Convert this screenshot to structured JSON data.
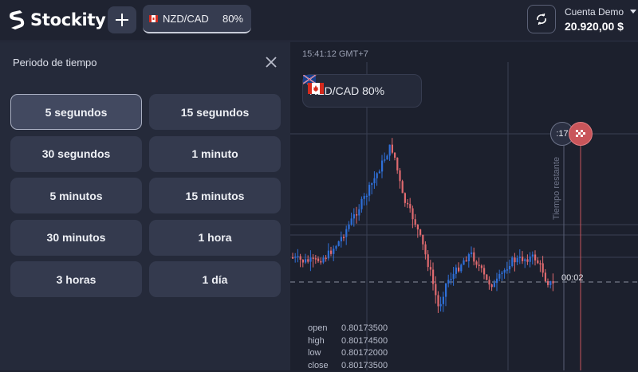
{
  "app": {
    "name": "Stockity"
  },
  "header": {
    "asset_tab": {
      "name": "NZD/CAD",
      "payout": "80%"
    },
    "account": {
      "label": "Cuenta Demo",
      "balance": "20.920,00 $"
    }
  },
  "timeframe_panel": {
    "title": "Periodo de tiempo",
    "options": [
      {
        "label": "5 segundos",
        "selected": true
      },
      {
        "label": "15 segundos",
        "selected": false
      },
      {
        "label": "30 segundos",
        "selected": false
      },
      {
        "label": "1 minuto",
        "selected": false
      },
      {
        "label": "5 minutos",
        "selected": false
      },
      {
        "label": "15 minutos",
        "selected": false
      },
      {
        "label": "30 minutos",
        "selected": false
      },
      {
        "label": "1 hora",
        "selected": false
      },
      {
        "label": "3 horas",
        "selected": false
      },
      {
        "label": "1 día",
        "selected": false
      }
    ]
  },
  "chart": {
    "time_label": "15:41:12 GMT+7",
    "pair": {
      "name": "NZD/CAD 80%"
    },
    "timer": ":17",
    "remaining_label": "Tiempo restante",
    "current_time_label": "00:02",
    "ohlc": {
      "open_label": "open",
      "open": "0.80173500",
      "high_label": "high",
      "high": "0.80174500",
      "low_label": "low",
      "low": "0.80172000",
      "close_label": "close",
      "close": "0.80173500"
    },
    "colors": {
      "up": "#2f6fd8",
      "down": "#e06a6f",
      "background": "#1c202d"
    }
  }
}
